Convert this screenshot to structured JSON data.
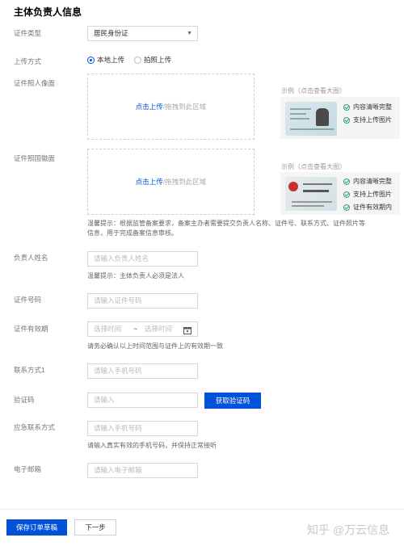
{
  "section_title": "主体负责人信息",
  "labels": {
    "id_type": "证件类型",
    "upload_method": "上传方式",
    "id_front": "证件照人像面",
    "id_back": "证件照国徽面",
    "name": "负责人姓名",
    "id_number": "证件号码",
    "validity": "证件有效期",
    "phone": "联系方式1",
    "verify_code": "验证码",
    "emergency": "应急联系方式",
    "email": "电子邮箱"
  },
  "id_type_value": "居民身份证",
  "upload_options": [
    "本地上传",
    "拍照上传"
  ],
  "upload_area": {
    "link": "点击上传",
    "text": "/拖拽到此区域"
  },
  "example": {
    "front_label": "示例（点击查看大图）",
    "back_label": "示例（点击查看大图）",
    "front_checks": [
      "内容清晰完整",
      "支持上传图片"
    ],
    "back_checks": [
      "内容清晰完整",
      "支持上传图片",
      "证件有效期内"
    ]
  },
  "hints": {
    "upload": "温馨提示：根据监管备案要求，备案主办者需要提交负责人名称、证件号、联系方式、证件照片等信息，用于完成备案信息审核。",
    "name": "温馨提示：主体负责人必须是法人",
    "validity": "请务必确认以上时间范围与证件上的有效期一致",
    "emergency": "请输入真实有效的手机号码，并保持正常接听"
  },
  "placeholders": {
    "name": "请输入负责人姓名",
    "id_number": "请输入证件号码",
    "start_time": "选择时间",
    "end_time": "选择时间",
    "phone": "请输入手机号码",
    "verify_code": "请输入",
    "emergency": "请输入手机号码",
    "email": "请输入电子邮箱"
  },
  "date_separator": "~",
  "buttons": {
    "get_code": "获取验证码",
    "save_draft": "保存订单草稿",
    "next": "下一步"
  },
  "watermark": "知乎 @万云信息"
}
